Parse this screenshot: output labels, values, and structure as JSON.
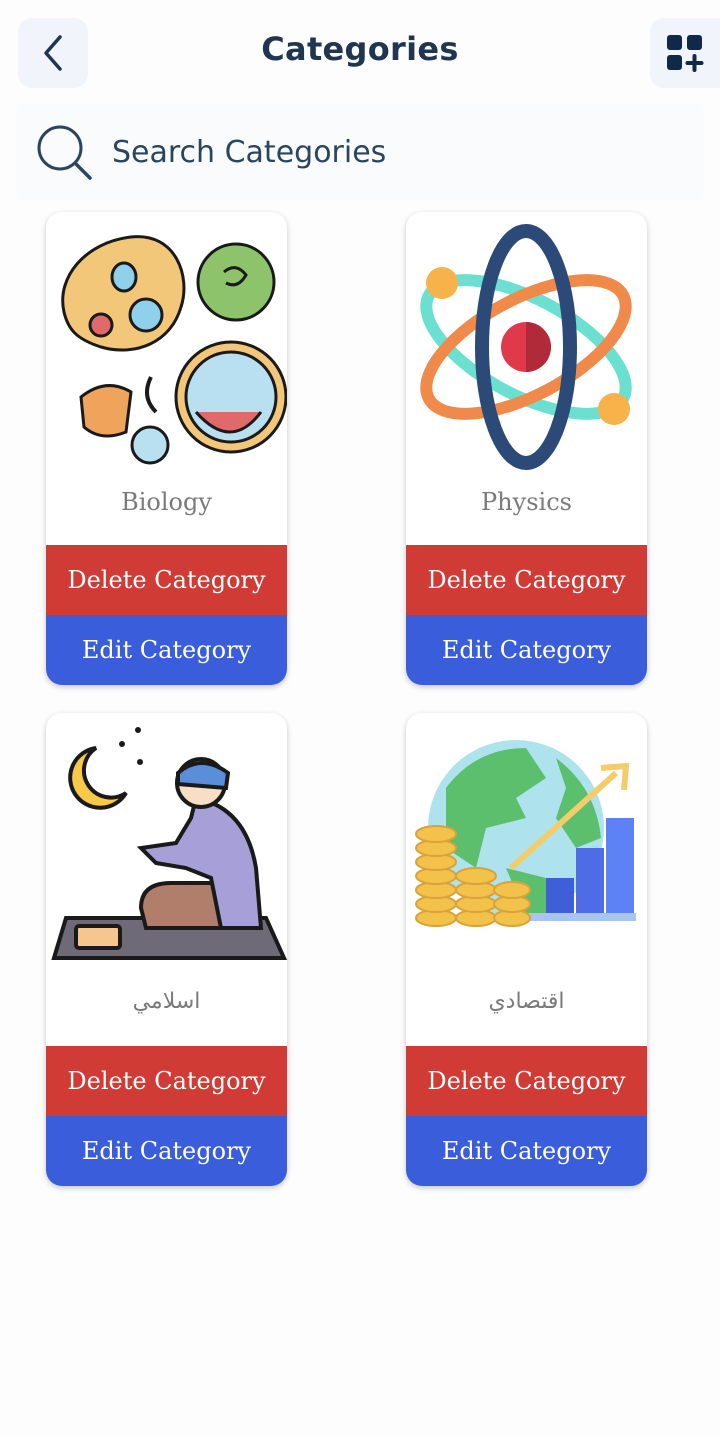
{
  "header": {
    "title": "Categories",
    "back_icon": "chevron-left-icon",
    "add_icon": "grid-add-icon"
  },
  "search": {
    "placeholder": "Search Categories",
    "value": "",
    "icon": "search-icon"
  },
  "categories": [
    {
      "name": "Biology",
      "image_icon": "microorganisms-illustration",
      "delete_label": "Delete Category",
      "edit_label": "Edit Category"
    },
    {
      "name": "Physics",
      "image_icon": "atom-illustration",
      "delete_label": "Delete Category",
      "edit_label": "Edit Category"
    },
    {
      "name": "اسلامي",
      "image_icon": "praying-man-illustration",
      "delete_label": "Delete Category",
      "edit_label": "Edit Category"
    },
    {
      "name": "اقتصادي",
      "image_icon": "globe-coins-chart-illustration",
      "delete_label": "Delete Category",
      "edit_label": "Edit Category"
    }
  ],
  "colors": {
    "delete": "#d03c35",
    "edit": "#3a5ddb",
    "title": "#1f3550"
  }
}
